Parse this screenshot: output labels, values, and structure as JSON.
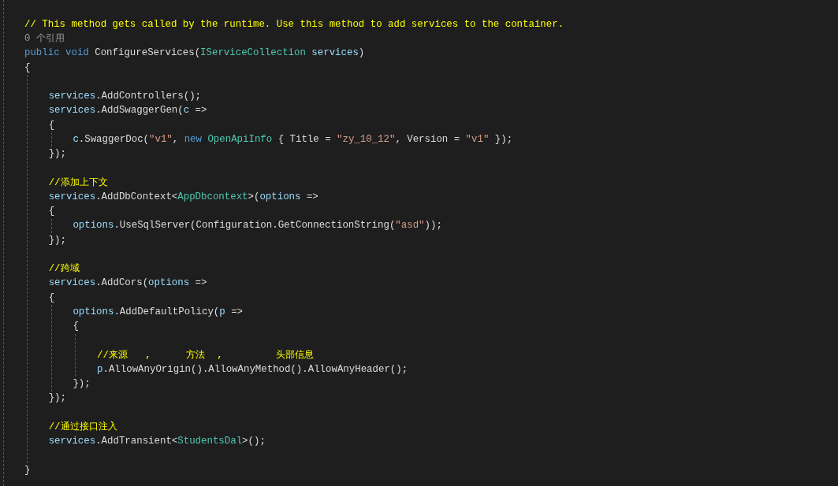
{
  "editor": {
    "lines": [
      {
        "kind": "code",
        "tokens": [
          {
            "kind": "comment",
            "text": "// This method gets called by the runtime. Use this method to add services to the container."
          }
        ]
      },
      {
        "kind": "lens",
        "text": "0 个引用"
      },
      {
        "kind": "code",
        "tokens": [
          {
            "kind": "keyword",
            "text": "public void"
          },
          {
            "kind": "plain",
            "text": " ConfigureServices("
          },
          {
            "kind": "type",
            "text": "IServiceCollection"
          },
          {
            "kind": "param",
            "text": " services"
          },
          {
            "kind": "plain",
            "text": ")"
          }
        ]
      },
      {
        "kind": "code",
        "tokens": [
          {
            "kind": "plain",
            "text": "{"
          }
        ]
      },
      {
        "kind": "block",
        "children": [
          {
            "kind": "blank"
          },
          {
            "kind": "code",
            "tokens": [
              {
                "kind": "param",
                "text": "services"
              },
              {
                "kind": "plain",
                "text": ".AddControllers();"
              }
            ]
          },
          {
            "kind": "code",
            "tokens": [
              {
                "kind": "param",
                "text": "services"
              },
              {
                "kind": "plain",
                "text": ".AddSwaggerGen("
              },
              {
                "kind": "param",
                "text": "c"
              },
              {
                "kind": "plain",
                "text": " =>"
              }
            ]
          },
          {
            "kind": "code",
            "tokens": [
              {
                "kind": "plain",
                "text": "{"
              }
            ]
          },
          {
            "kind": "block",
            "children": [
              {
                "kind": "code",
                "tokens": [
                  {
                    "kind": "param",
                    "text": "c"
                  },
                  {
                    "kind": "plain",
                    "text": ".SwaggerDoc("
                  },
                  {
                    "kind": "string",
                    "text": "\"v1\""
                  },
                  {
                    "kind": "plain",
                    "text": ", "
                  },
                  {
                    "kind": "keyword",
                    "text": "new"
                  },
                  {
                    "kind": "type",
                    "text": " OpenApiInfo"
                  },
                  {
                    "kind": "plain",
                    "text": " { Title = "
                  },
                  {
                    "kind": "string",
                    "text": "\"zy_10_12\""
                  },
                  {
                    "kind": "plain",
                    "text": ", Version = "
                  },
                  {
                    "kind": "string",
                    "text": "\"v1\""
                  },
                  {
                    "kind": "plain",
                    "text": " });"
                  }
                ]
              }
            ]
          },
          {
            "kind": "code",
            "tokens": [
              {
                "kind": "plain",
                "text": "});"
              }
            ]
          },
          {
            "kind": "blank"
          },
          {
            "kind": "code",
            "tokens": [
              {
                "kind": "comment",
                "text": "//添加上下文"
              }
            ]
          },
          {
            "kind": "code",
            "tokens": [
              {
                "kind": "param",
                "text": "services"
              },
              {
                "kind": "plain",
                "text": ".AddDbContext<"
              },
              {
                "kind": "type",
                "text": "AppDbcontext"
              },
              {
                "kind": "plain",
                "text": ">("
              },
              {
                "kind": "param",
                "text": "options"
              },
              {
                "kind": "plain",
                "text": " =>"
              }
            ]
          },
          {
            "kind": "code",
            "tokens": [
              {
                "kind": "plain",
                "text": "{"
              }
            ]
          },
          {
            "kind": "block",
            "children": [
              {
                "kind": "code",
                "tokens": [
                  {
                    "kind": "param",
                    "text": "options"
                  },
                  {
                    "kind": "plain",
                    "text": ".UseSqlServer(Configuration.GetConnectionString("
                  },
                  {
                    "kind": "string",
                    "text": "\"asd\""
                  },
                  {
                    "kind": "plain",
                    "text": "));"
                  }
                ]
              }
            ]
          },
          {
            "kind": "code",
            "tokens": [
              {
                "kind": "plain",
                "text": "});"
              }
            ]
          },
          {
            "kind": "blank"
          },
          {
            "kind": "code",
            "tokens": [
              {
                "kind": "comment",
                "text": "//跨域"
              }
            ]
          },
          {
            "kind": "code",
            "tokens": [
              {
                "kind": "param",
                "text": "services"
              },
              {
                "kind": "plain",
                "text": ".AddCors("
              },
              {
                "kind": "param",
                "text": "options"
              },
              {
                "kind": "plain",
                "text": " =>"
              }
            ]
          },
          {
            "kind": "code",
            "tokens": [
              {
                "kind": "plain",
                "text": "{"
              }
            ]
          },
          {
            "kind": "block",
            "children": [
              {
                "kind": "code",
                "tokens": [
                  {
                    "kind": "param",
                    "text": "options"
                  },
                  {
                    "kind": "plain",
                    "text": ".AddDefaultPolicy("
                  },
                  {
                    "kind": "param",
                    "text": "p"
                  },
                  {
                    "kind": "plain",
                    "text": " =>"
                  }
                ]
              },
              {
                "kind": "code",
                "tokens": [
                  {
                    "kind": "plain",
                    "text": "{"
                  }
                ]
              },
              {
                "kind": "block",
                "children": [
                  {
                    "kind": "blank"
                  },
                  {
                    "kind": "code",
                    "tokens": [
                      {
                        "kind": "comment",
                        "text": "//来源   ,      方法  ,         头部信息"
                      }
                    ]
                  },
                  {
                    "kind": "code",
                    "tokens": [
                      {
                        "kind": "param",
                        "text": "p"
                      },
                      {
                        "kind": "plain",
                        "text": ".AllowAnyOrigin().AllowAnyMethod().AllowAnyHeader();"
                      }
                    ]
                  }
                ]
              },
              {
                "kind": "code",
                "tokens": [
                  {
                    "kind": "plain",
                    "text": "});"
                  }
                ]
              }
            ]
          },
          {
            "kind": "code",
            "tokens": [
              {
                "kind": "plain",
                "text": "});"
              }
            ]
          },
          {
            "kind": "blank"
          },
          {
            "kind": "code",
            "tokens": [
              {
                "kind": "comment",
                "text": "//通过接口注入"
              }
            ]
          },
          {
            "kind": "code",
            "tokens": [
              {
                "kind": "param",
                "text": "services"
              },
              {
                "kind": "plain",
                "text": ".AddTransient<"
              },
              {
                "kind": "type",
                "text": "StudentsDal"
              },
              {
                "kind": "plain",
                "text": ">();"
              }
            ]
          },
          {
            "kind": "blank"
          }
        ]
      },
      {
        "kind": "code",
        "tokens": [
          {
            "kind": "plain",
            "text": "}"
          }
        ]
      }
    ]
  }
}
